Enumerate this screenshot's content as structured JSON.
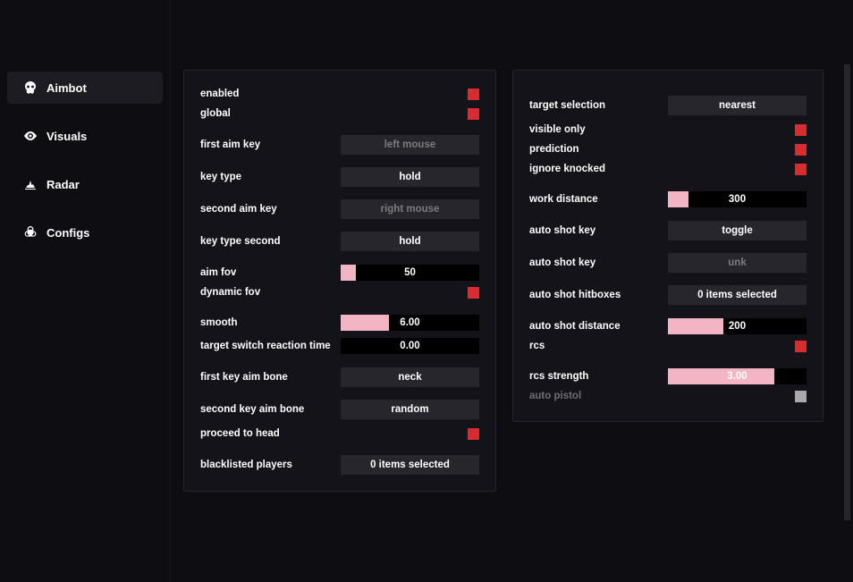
{
  "sidebar": {
    "items": [
      {
        "label": "Aimbot",
        "active": true
      },
      {
        "label": "Visuals",
        "active": false
      },
      {
        "label": "Radar",
        "active": false
      },
      {
        "label": "Configs",
        "active": false
      }
    ]
  },
  "left": {
    "enabled_label": "enabled",
    "global_label": "global",
    "first_aim_key_label": "first aim key",
    "first_aim_key_value": "left mouse",
    "key_type_label": "key type",
    "key_type_value": "hold",
    "second_aim_key_label": "second aim key",
    "second_aim_key_value": "right mouse",
    "key_type_second_label": "key type second",
    "key_type_second_value": "hold",
    "aim_fov_label": "aim fov",
    "aim_fov_value": "50",
    "aim_fov_fill": 11,
    "dynamic_fov_label": "dynamic fov",
    "smooth_label": "smooth",
    "smooth_value": "6.00",
    "smooth_fill": 35,
    "tsrt_label": "target switch reaction time",
    "tsrt_value": "0.00",
    "tsrt_fill": 0,
    "first_bone_label": "first key aim bone",
    "first_bone_value": "neck",
    "second_bone_label": "second key aim bone",
    "second_bone_value": "random",
    "proceed_label": "proceed to head",
    "blacklist_label": "blacklisted players",
    "blacklist_value": "0 items selected"
  },
  "right": {
    "target_selection_label": "target selection",
    "target_selection_value": "nearest",
    "visible_only_label": "visible only",
    "prediction_label": "prediction",
    "ignore_knocked_label": "ignore knocked",
    "work_distance_label": "work distance",
    "work_distance_value": "300",
    "work_distance_fill": 15,
    "auto_shot_key_label": "auto shot key",
    "auto_shot_key_value": "toggle",
    "auto_shot_key2_label": "auto shot key",
    "auto_shot_key2_value": "unk",
    "auto_shot_hitboxes_label": "auto shot hitboxes",
    "auto_shot_hitboxes_value": "0 items selected",
    "auto_shot_distance_label": "auto shot distance",
    "auto_shot_distance_value": "200",
    "auto_shot_distance_fill": 40,
    "rcs_label": "rcs",
    "rcs_strength_label": "rcs strength",
    "rcs_strength_value": "3.00",
    "rcs_strength_fill": 77,
    "auto_pistol_label": "auto pistol"
  }
}
